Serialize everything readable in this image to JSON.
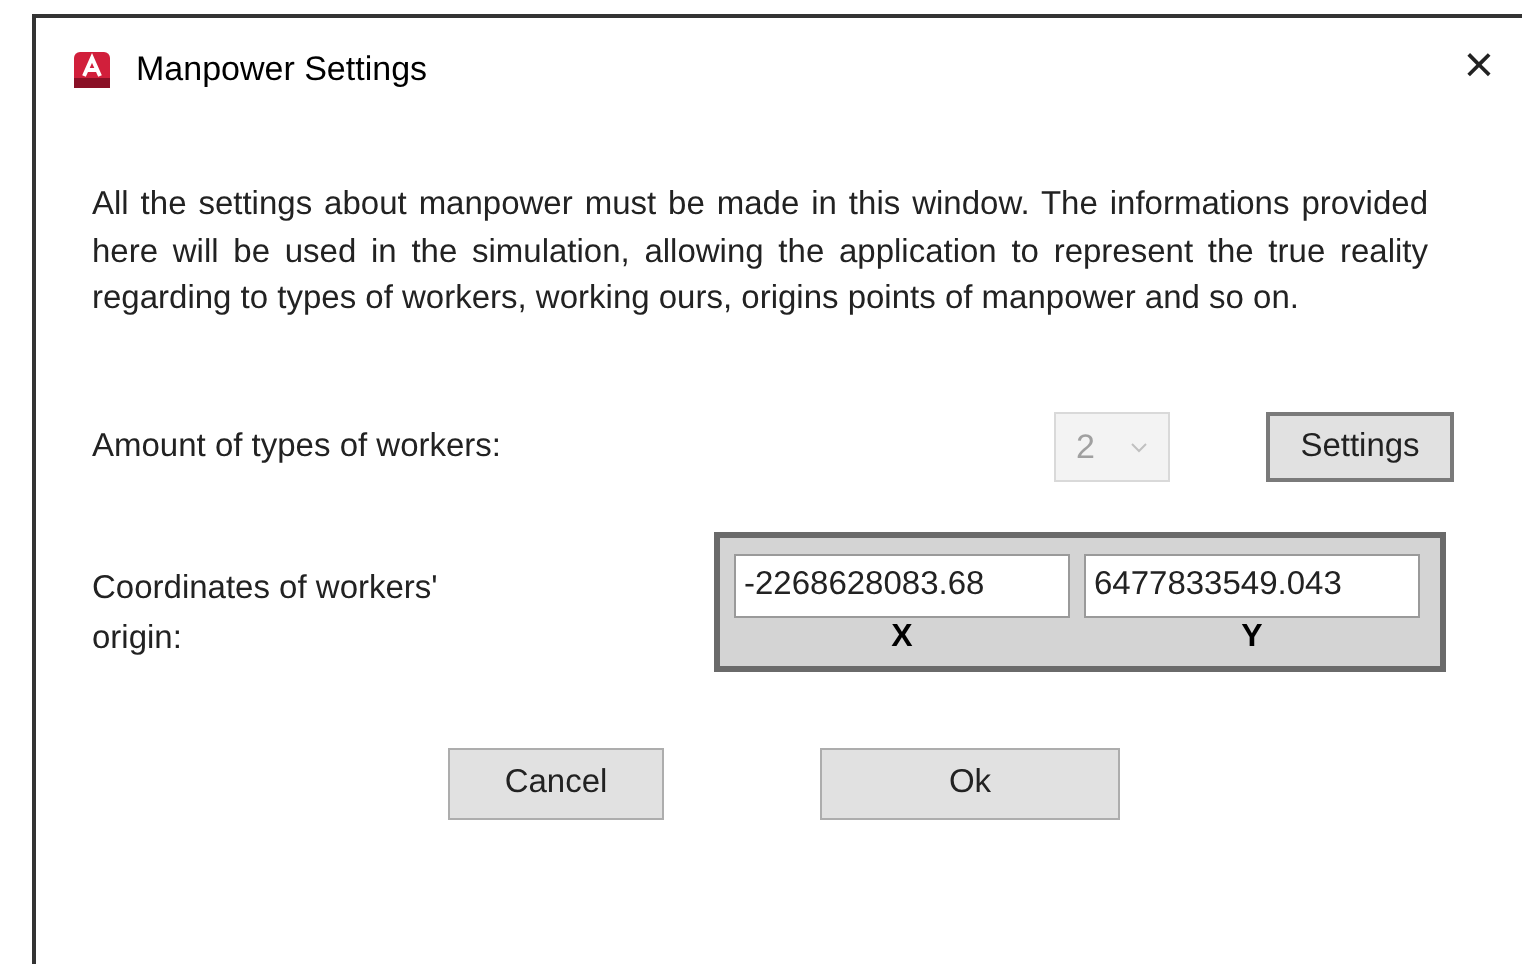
{
  "window": {
    "title": "Manpower Settings",
    "close": "×"
  },
  "description": "All the settings about manpower must be made in this window. The informations provided here will be used in the simulation, allowing the application to represent the true reality regarding to types of workers, working ours, origins points of manpower and so on.",
  "worker_types": {
    "label": "Amount of types of workers:",
    "value": "2",
    "disabled": true,
    "button": "Settings"
  },
  "origin": {
    "label": "Coordinates of workers' origin:",
    "fields": [
      {
        "value": "-2268628083.68",
        "caption": "X"
      },
      {
        "value": "6477833549.043",
        "caption": "Y"
      }
    ]
  },
  "buttons": [
    "Cancel",
    "Ok"
  ]
}
